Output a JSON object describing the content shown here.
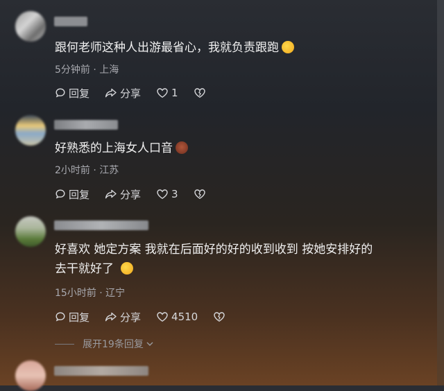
{
  "comments": [
    {
      "text": "跟何老师这种人出游最省心，我就负责跟跑",
      "meta": "5分钟前 · 上海",
      "reply_label": "回复",
      "share_label": "分享",
      "likes": "1"
    },
    {
      "text": "好熟悉的上海女人口音",
      "meta": "2小时前 · 江苏",
      "reply_label": "回复",
      "share_label": "分享",
      "likes": "3"
    },
    {
      "text_line1": "好喜欢 她定方案 我就在后面好的好的收到收到 按她安排好的",
      "text_line2": "去干就好了",
      "meta": "15小时前 · 辽宁",
      "reply_label": "回复",
      "share_label": "分享",
      "likes": "4510",
      "expand_replies": "展开19条回复"
    }
  ],
  "colors": {
    "bg_top": "#2a2d33",
    "bg_bottom": "#6a4224",
    "text": "#f0f0f0",
    "meta": "#a9aab0"
  }
}
